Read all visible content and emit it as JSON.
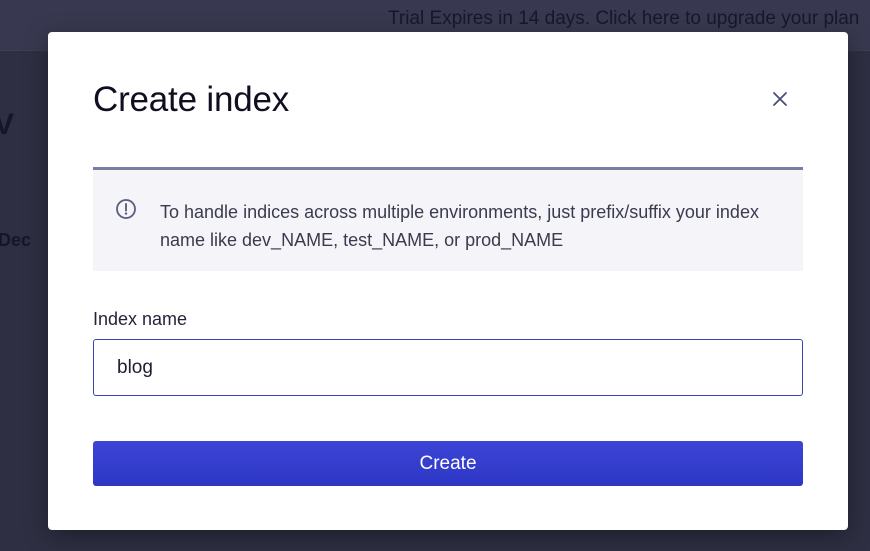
{
  "background": {
    "banner_text": "Trial Expires in 14 days. Click here to upgrade your plan",
    "heading_fragment": "V",
    "sub_fragment": "Dec"
  },
  "modal": {
    "title": "Create index",
    "close_icon": "close-icon",
    "info": {
      "icon": "info-circle-icon",
      "text": "To handle indices across multiple environments, just prefix/suffix your index name like dev_NAME, test_NAME, or prod_NAME"
    },
    "field": {
      "label": "Index name",
      "value": "blog",
      "placeholder": ""
    },
    "create_label": "Create"
  },
  "colors": {
    "primary": "#3a44d4",
    "overlay": "#2e2f42",
    "info_background": "#f4f4f9",
    "info_border": "#7a7ca0"
  }
}
